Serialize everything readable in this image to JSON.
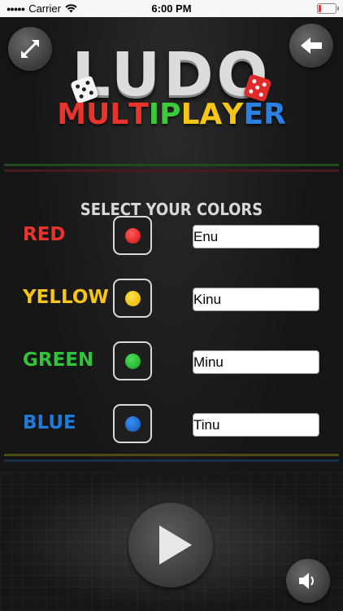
{
  "status_bar": {
    "carrier": "Carrier",
    "time": "6:00 PM"
  },
  "header": {
    "title_main": "LUDO",
    "title_sub_letters": [
      {
        "ch": "M",
        "color": "#e8342c"
      },
      {
        "ch": "U",
        "color": "#e8342c"
      },
      {
        "ch": "L",
        "color": "#e8342c"
      },
      {
        "ch": "T",
        "color": "#e8342c"
      },
      {
        "ch": "I",
        "color": "#3cc93a"
      },
      {
        "ch": "P",
        "color": "#3cc93a"
      },
      {
        "ch": "L",
        "color": "#f5c518"
      },
      {
        "ch": "A",
        "color": "#f5c518"
      },
      {
        "ch": "Y",
        "color": "#f5c518"
      },
      {
        "ch": "E",
        "color": "#2a7fe0"
      },
      {
        "ch": "R",
        "color": "#2a7fe0"
      }
    ],
    "left_icon": "expand-arrows-icon",
    "right_icon": "back-arrow-icon"
  },
  "select_title": "SELECT YOUR COLORS",
  "players": [
    {
      "label": "RED",
      "label_color": "#e8342c",
      "dot_color": "#e01818",
      "name": "Enu"
    },
    {
      "label": "YELLOW",
      "label_color": "#f5c518",
      "dot_color": "#f2cc10",
      "name": "Kinu"
    },
    {
      "label": "GREEN",
      "label_color": "#2fc43a",
      "dot_color": "#22b830",
      "name": "Minu"
    },
    {
      "label": "BLUE",
      "label_color": "#1f7ad8",
      "dot_color": "#1a70cc",
      "name": "Tinu"
    }
  ],
  "footer": {
    "play_icon": "play-icon",
    "sound_icon": "speaker-icon"
  }
}
